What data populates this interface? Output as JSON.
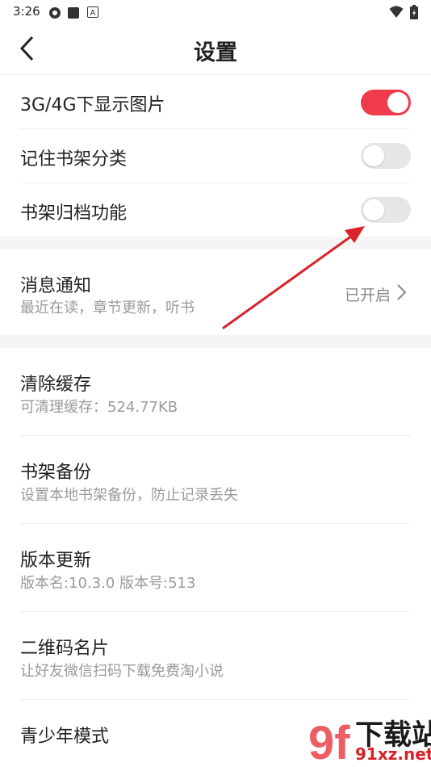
{
  "status_bar": {
    "time": "3:26"
  },
  "header": {
    "title": "设置"
  },
  "toggles": [
    {
      "label": "3G/4G下显示图片",
      "state": "on"
    },
    {
      "label": "记住书架分类",
      "state": "off"
    },
    {
      "label": "书架归档功能",
      "state": "off"
    }
  ],
  "notification": {
    "title": "消息通知",
    "subtitle": "最近在读，章节更新，听书",
    "value": "已开启"
  },
  "items": [
    {
      "title": "清除缓存",
      "subtitle": "可清理缓存：524.77KB"
    },
    {
      "title": "书架备份",
      "subtitle": "设置本地书架备份，防止记录丢失"
    },
    {
      "title": "版本更新",
      "subtitle": "版本名:10.3.0  版本号:513"
    },
    {
      "title": "二维码名片",
      "subtitle": "让好友微信扫码下载免费淘小说"
    },
    {
      "title": "青少年模式"
    }
  ],
  "watermark": {
    "text": "下载站",
    "url_text": "91xz.net",
    "logo_text": "9f"
  },
  "colors": {
    "accent": "#f03b4d",
    "annotation_arrow": "#d9222a"
  }
}
